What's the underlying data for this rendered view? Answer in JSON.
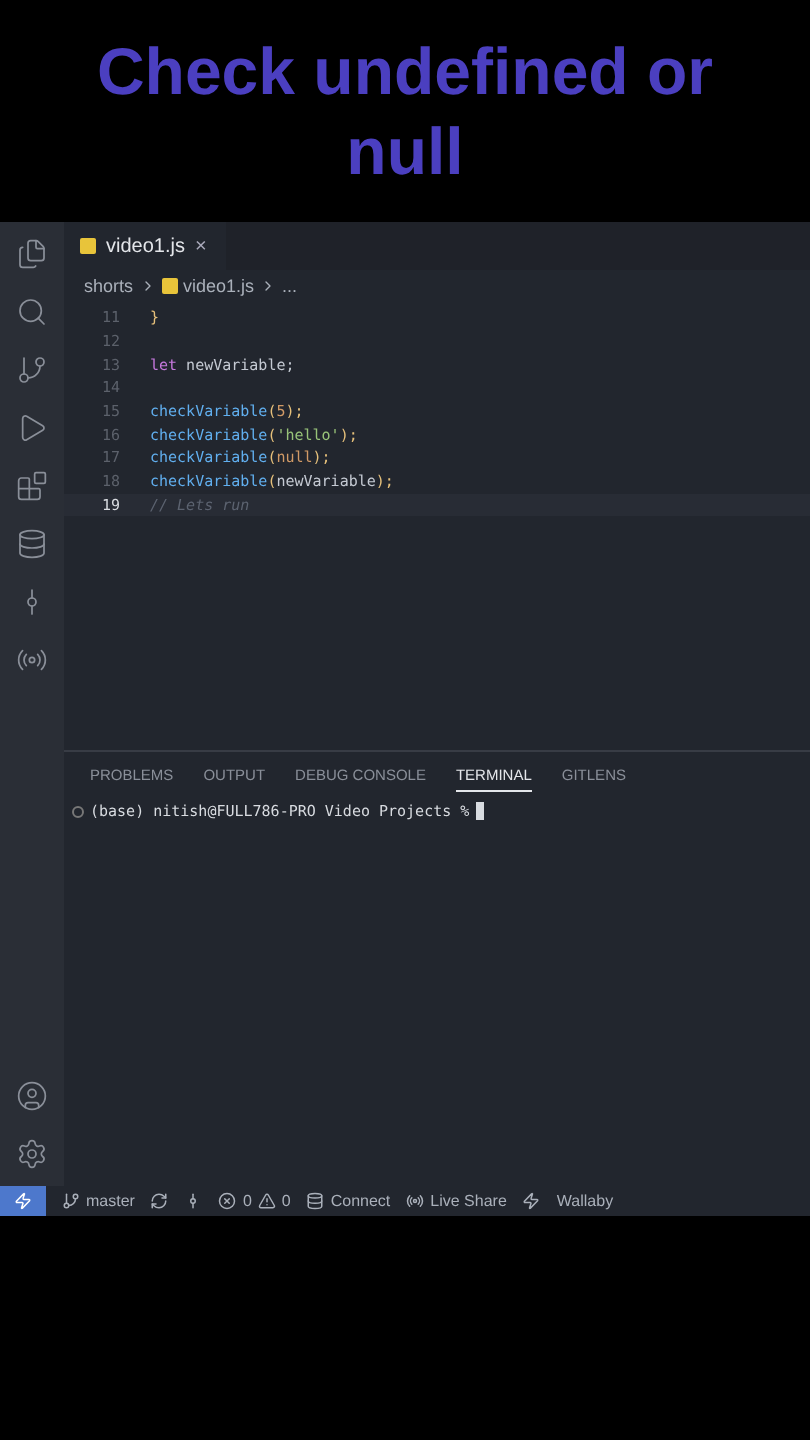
{
  "headline": "Check undefined or null",
  "tabs": [
    {
      "label": "video1.js",
      "selected": true,
      "close": "×"
    }
  ],
  "breadcrumb": [
    "shorts",
    "video1.js",
    "..."
  ],
  "code": [
    {
      "number": "11",
      "current": false,
      "tokens": [
        {
          "text": "}",
          "kind": "brace"
        }
      ]
    },
    {
      "number": "12",
      "current": false
    },
    {
      "number": "13",
      "current": false,
      "tokens": [
        {
          "text": "let",
          "kind": "keyword"
        },
        {
          "text": " newVariable;",
          "kind": "plain"
        }
      ]
    },
    {
      "number": "14",
      "current": false
    },
    {
      "number": "15",
      "current": false,
      "tokens": [
        {
          "text": "checkVariable",
          "kind": "function"
        },
        {
          "text": "(",
          "kind": "brace"
        },
        {
          "text": "5",
          "kind": "number"
        },
        {
          "text": ");",
          "kind": "brace"
        }
      ]
    },
    {
      "number": "16",
      "current": false,
      "tokens": [
        {
          "text": "checkVariable",
          "kind": "function"
        },
        {
          "text": "(",
          "kind": "brace"
        },
        {
          "text": "'hello'",
          "kind": "string"
        },
        {
          "text": ");",
          "kind": "brace"
        }
      ]
    },
    {
      "number": "17",
      "current": false,
      "tokens": [
        {
          "text": "checkVariable",
          "kind": "function"
        },
        {
          "text": "(",
          "kind": "brace"
        },
        {
          "text": "null",
          "kind": "number"
        },
        {
          "text": ");",
          "kind": "brace"
        }
      ]
    },
    {
      "number": "18",
      "current": false,
      "tokens": [
        {
          "text": "checkVariable",
          "kind": "function"
        },
        {
          "text": "(",
          "kind": "brace"
        },
        {
          "text": "newVariable",
          "kind": "plain"
        },
        {
          "text": ");",
          "kind": "brace"
        }
      ]
    },
    {
      "number": "19",
      "current": true,
      "tokens": [
        {
          "text": "// Lets run",
          "kind": "comment"
        }
      ]
    }
  ],
  "panel_tabs": [
    {
      "label": "PROBLEMS",
      "selected": false
    },
    {
      "label": "OUTPUT",
      "selected": false
    },
    {
      "label": "DEBUG CONSOLE",
      "selected": false
    },
    {
      "label": "TERMINAL",
      "selected": true
    },
    {
      "label": "GITLENS",
      "selected": false
    }
  ],
  "terminal": {
    "prompt": "(base) nitish@FULL786-PRO Video Projects %"
  },
  "status_bar": {
    "branch": "master",
    "errors": "0",
    "warnings": "0",
    "connect": "Connect",
    "live_share": "Live Share",
    "wallaby": "Wallaby"
  }
}
